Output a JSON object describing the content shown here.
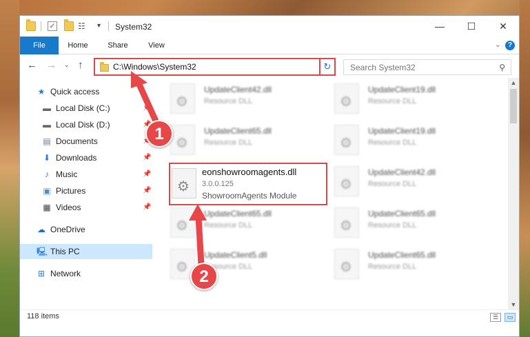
{
  "window": {
    "title": "System32",
    "controls": {
      "minimize": "—",
      "maximize": "☐",
      "close": "✕"
    }
  },
  "ribbon": {
    "tabs": [
      {
        "label": "File"
      },
      {
        "label": "Home"
      },
      {
        "label": "Share"
      },
      {
        "label": "View"
      }
    ],
    "help": "?"
  },
  "address": {
    "path": "C:\\Windows\\System32",
    "search_placeholder": "Search System32"
  },
  "sidebar": {
    "quick_access": "Quick access",
    "items": [
      {
        "label": "Local Disk (C:)"
      },
      {
        "label": "Local Disk (D:)"
      },
      {
        "label": "Documents"
      },
      {
        "label": "Downloads"
      },
      {
        "label": "Music"
      },
      {
        "label": "Pictures"
      },
      {
        "label": "Videos"
      }
    ],
    "onedrive": "OneDrive",
    "this_pc": "This PC",
    "network": "Network"
  },
  "files": {
    "blurred": [
      {
        "name": "UpdateClient42.dll",
        "type": "Resource DLL"
      },
      {
        "name": "UpdateClient19.dll",
        "type": "Resource DLL"
      },
      {
        "name": "UpdateClient65.dll",
        "type": "Resource DLL"
      },
      {
        "name": "UpdateClient19.dll",
        "type": "Resource DLL"
      },
      {
        "name": "UpdateClient42.dll",
        "type": "Resource DLL"
      },
      {
        "name": "UpdateClient65.dll",
        "type": "Resource DLL"
      },
      {
        "name": "UpdateClient65.dll",
        "type": "Resource DLL"
      },
      {
        "name": "UpdateClient5.dll",
        "type": "Resource DLL"
      },
      {
        "name": "UpdateClient65.dll",
        "type": "Resource DLL"
      }
    ],
    "highlighted": {
      "name": "eonshowroomagents.dll",
      "version": "3.0.0.125",
      "description": "ShowroomAgents Module"
    }
  },
  "status": {
    "count": "118 items"
  },
  "callouts": {
    "one": "1",
    "two": "2"
  },
  "colors": {
    "accent": "#1979ca",
    "highlight": "#d94848",
    "callout": "#e8474a"
  }
}
